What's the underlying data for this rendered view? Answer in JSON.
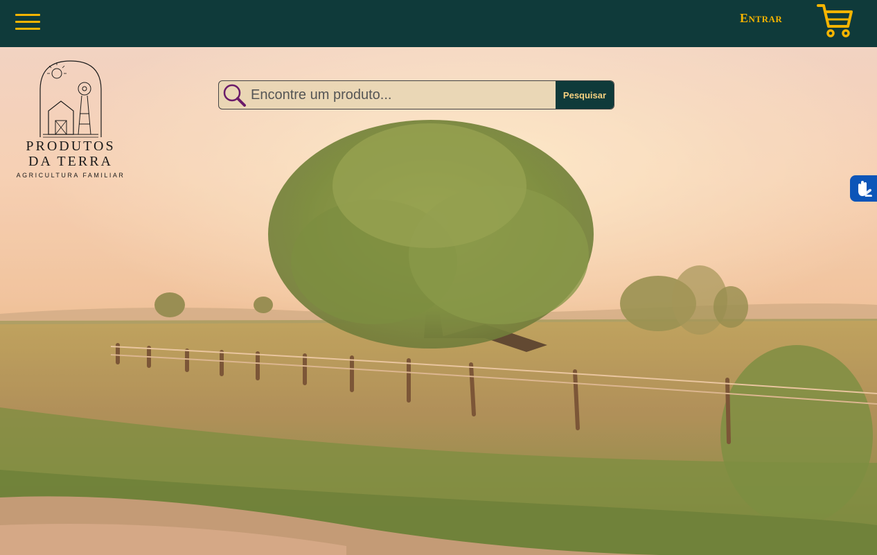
{
  "header": {
    "login_label": "Entrar",
    "icons": {
      "menu": "hamburger-icon",
      "cart": "shopping-cart-icon"
    }
  },
  "logo": {
    "line1": "PRODUTOS",
    "line2": "DA TERRA",
    "tagline": "AGRICULTURA FAMILIAR"
  },
  "search": {
    "placeholder": "Encontre um produto...",
    "button_label": "Pesquisar",
    "icon": "magnifier-icon"
  },
  "accessibility": {
    "icon": "sign-language-hands-icon"
  },
  "colors": {
    "header_bg": "#0f3a3a",
    "accent": "#f5b400",
    "vlibras_blue": "#0c55b8"
  }
}
